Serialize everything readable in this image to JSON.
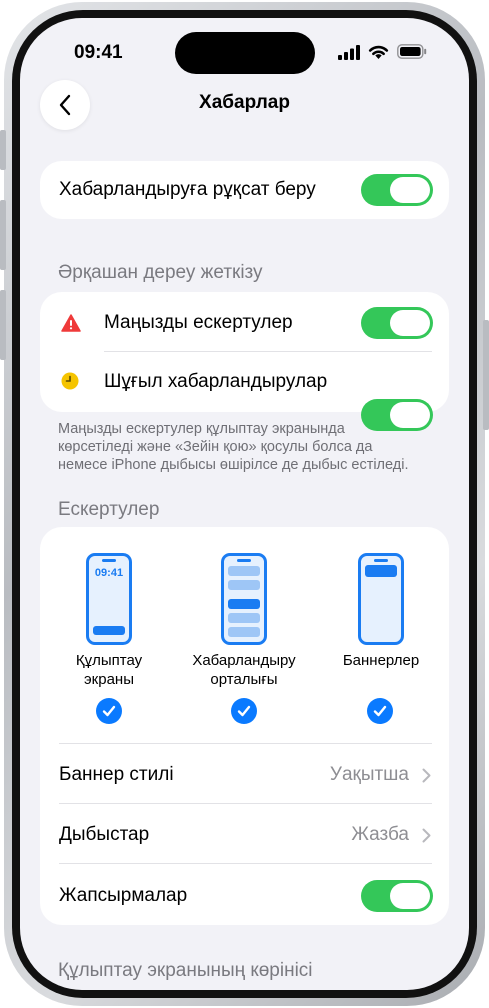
{
  "status_bar": {
    "time": "09:41"
  },
  "nav": {
    "title": "Хабарлар"
  },
  "allow_notifications": {
    "label": "Хабарландыруға рұқсат беру",
    "on": true
  },
  "always_deliver": {
    "header": "Әрқашан дереу жеткізу",
    "items": [
      {
        "label": "Маңызды ескертулер",
        "icon": "warning-triangle-icon",
        "on": true
      },
      {
        "label": "Шұғыл хабарландырулар",
        "icon": "clock-badge-icon",
        "on": true
      }
    ],
    "footnote": [
      "Маңызды ескертулер құлыптау экранында",
      "көрсетіледі және «Зейін қою» қосулы болса да",
      "немесе iPhone дыбысы өшірілсе де дыбыс естіледі."
    ]
  },
  "alerts": {
    "header": "Ескертулер",
    "options": [
      {
        "label_lines": [
          "Құлыптау",
          "экраны"
        ],
        "preview_time": "09:41",
        "checked": true
      },
      {
        "label_lines": [
          "Хабарландыру",
          "орталығы"
        ],
        "checked": true
      },
      {
        "label_lines": [
          "Баннерлер"
        ],
        "checked": true
      }
    ],
    "banner_style": {
      "label": "Баннер стилі",
      "value": "Уақытша"
    },
    "sounds": {
      "label": "Дыбыстар",
      "value": "Жазба"
    },
    "badges": {
      "label": "Жапсырмалар",
      "on": true
    }
  },
  "lock_screen_section": {
    "header": "Құлыптау экранының көрінісі"
  },
  "colors": {
    "accent": "#0a7aff",
    "toggle_on": "#34c759",
    "background": "#f2f2f7"
  }
}
